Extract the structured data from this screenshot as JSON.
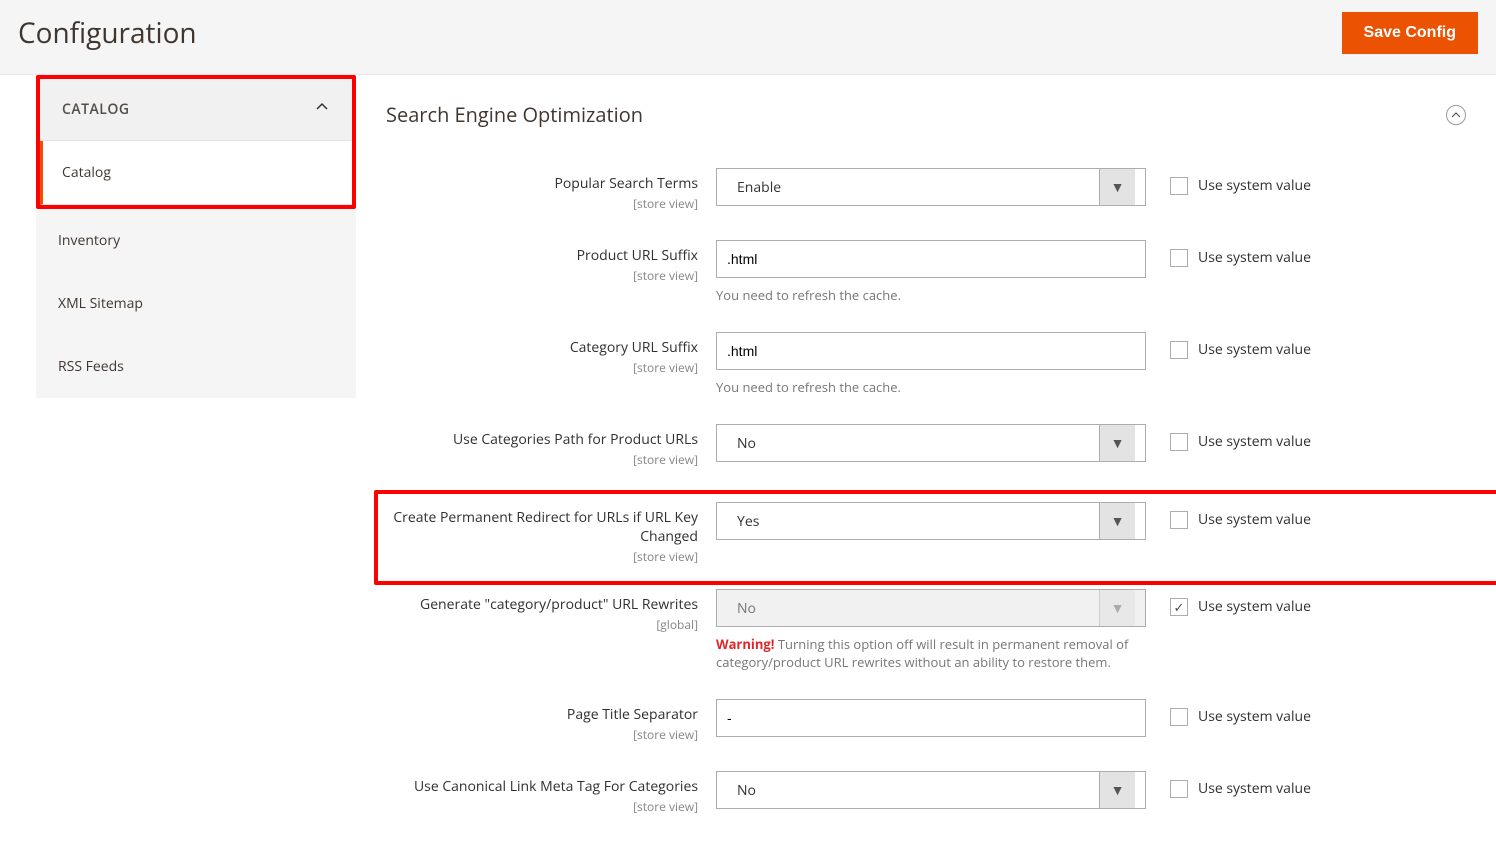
{
  "page_title": "Configuration",
  "save_button": "Save Config",
  "sidebar": {
    "group_label": "CATALOG",
    "items": [
      {
        "label": "Catalog",
        "active": true
      },
      {
        "label": "Inventory"
      },
      {
        "label": "XML Sitemap"
      },
      {
        "label": "RSS Feeds"
      }
    ]
  },
  "section": {
    "title": "Search Engine Optimization"
  },
  "system_value_label": "Use system value",
  "fields": {
    "popular_search_terms": {
      "label": "Popular Search Terms",
      "scope": "[store view]",
      "value": "Enable"
    },
    "product_url_suffix": {
      "label": "Product URL Suffix",
      "scope": "[store view]",
      "value": ".html",
      "note": "You need to refresh the cache."
    },
    "category_url_suffix": {
      "label": "Category URL Suffix",
      "scope": "[store view]",
      "value": ".html",
      "note": "You need to refresh the cache."
    },
    "use_categories_path": {
      "label": "Use Categories Path for Product URLs",
      "scope": "[store view]",
      "value": "No"
    },
    "permanent_redirect": {
      "label": "Create Permanent Redirect for URLs if URL Key Changed",
      "scope": "[store view]",
      "value": "Yes"
    },
    "generate_rewrites": {
      "label": "Generate \"category/product\" URL Rewrites",
      "scope": "[global]",
      "value": "No",
      "warning_label": "Warning!",
      "warning_text": " Turning this option off will result in permanent removal of category/product URL rewrites without an ability to restore them."
    },
    "page_title_separator": {
      "label": "Page Title Separator",
      "scope": "[store view]",
      "value": "-"
    },
    "canonical_categories": {
      "label": "Use Canonical Link Meta Tag For Categories",
      "scope": "[store view]",
      "value": "No"
    }
  }
}
